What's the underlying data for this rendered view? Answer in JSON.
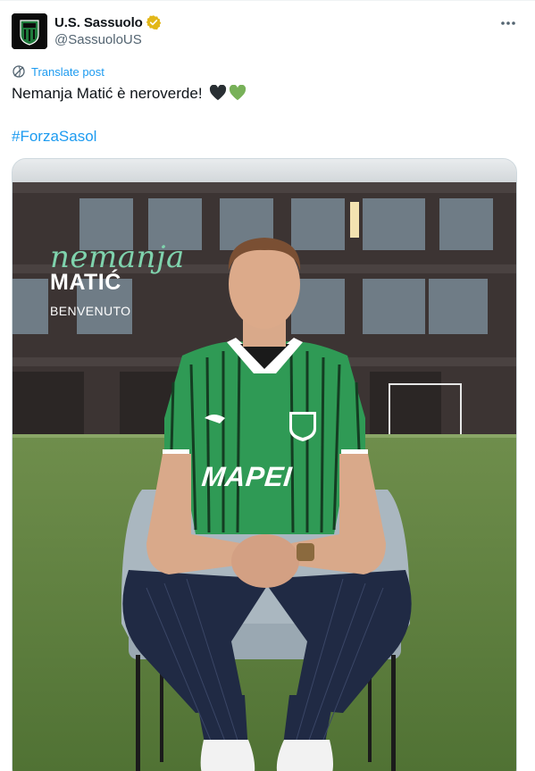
{
  "post": {
    "author": {
      "display_name": "U.S. Sassuolo",
      "handle": "@SassuoloUS",
      "verified_badge_icon": "gold-verified-badge-icon"
    },
    "more_icon": "more-horizontal-icon",
    "translate": {
      "icon": "translate-globe-icon",
      "label": "Translate post"
    },
    "text": "Nemanja Matić è neroverde!",
    "emojis": [
      "black-heart-icon",
      "green-heart-icon"
    ],
    "hashtag": "#ForzaSasol",
    "media": {
      "overlay_first_name": "nemanja",
      "overlay_last_name": "MATIĆ",
      "overlay_subtitle": "BENVENUTO",
      "jersey_sponsor": "MAPEI"
    }
  },
  "colors": {
    "link": "#1d9bf0",
    "secondary_text": "#536471",
    "verified_gold": "#e2b719",
    "overlay_green": "#7fd3ad",
    "jersey_green": "#2f9a55"
  }
}
